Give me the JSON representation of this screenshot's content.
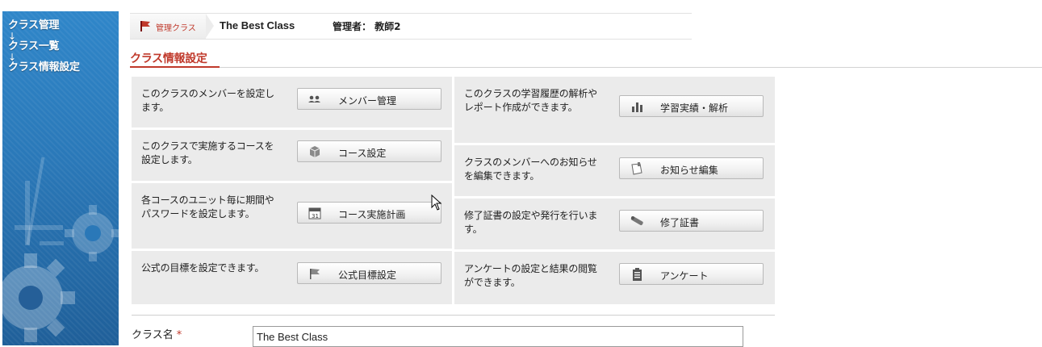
{
  "sidebar": {
    "breadcrumb": [
      "クラス管理",
      "↓",
      "クラス一覧",
      "↓",
      "クラス情報設定"
    ]
  },
  "header": {
    "tag_label": "管理クラス",
    "class_name": "The Best Class",
    "admin": "管理者： 教師2"
  },
  "section": {
    "title": "クラス情報設定"
  },
  "grid": {
    "left": [
      {
        "desc": "このクラスのメンバーを設定します。",
        "button": "メンバー管理",
        "icon": "members-icon"
      },
      {
        "desc": "このクラスで実施するコースを設定します。",
        "button": "コース設定",
        "icon": "course-icon"
      },
      {
        "desc": "各コースのユニット毎に期間やパスワードを設定します。",
        "button": "コース実施計画",
        "icon": "calendar-icon"
      },
      {
        "desc": "公式の目標を設定できます。",
        "button": "公式目標設定",
        "icon": "flag-icon"
      }
    ],
    "right": [
      {
        "desc": "このクラスの学習履歴の解析やレポート作成ができます。",
        "button": "学習実績・解析",
        "icon": "bar-chart-icon"
      },
      {
        "desc": "クラスのメンバーへのお知らせを編集できます。",
        "button": "お知らせ編集",
        "icon": "note-icon"
      },
      {
        "desc": "修了証書の設定や発行を行います。",
        "button": "修了証書",
        "icon": "certificate-icon"
      },
      {
        "desc": "アンケートの設定と結果の閲覧ができます。",
        "button": "アンケート",
        "icon": "clipboard-icon"
      }
    ]
  },
  "form": {
    "class_name_label": "クラス名",
    "required_mark": "*",
    "class_name_value": "The Best Class"
  }
}
